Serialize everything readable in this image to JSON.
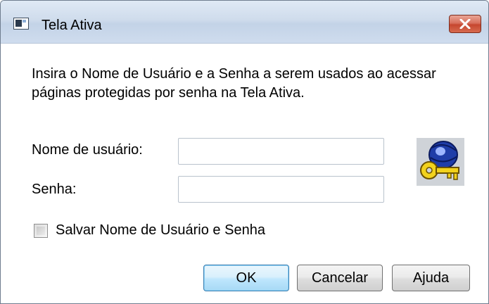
{
  "window": {
    "title": "Tela Ativa",
    "app_icon": "window-app-icon",
    "close_icon": "close-icon"
  },
  "dialog": {
    "instructions": "Insira o Nome de Usuário e a Senha a serem usados ao acessar páginas protegidas por senha na Tela Ativa.",
    "username_label": "Nome de usuário:",
    "username_value": "",
    "password_label": "Senha:",
    "password_value": "",
    "save_checkbox_label": "Salvar Nome de Usuário e Senha",
    "save_checked": false,
    "key_icon": "key-globe-icon"
  },
  "buttons": {
    "ok": "OK",
    "cancel": "Cancelar",
    "help": "Ajuda"
  },
  "colors": {
    "close_button": "#c6472f",
    "default_button_border": "#3c7fb1"
  }
}
